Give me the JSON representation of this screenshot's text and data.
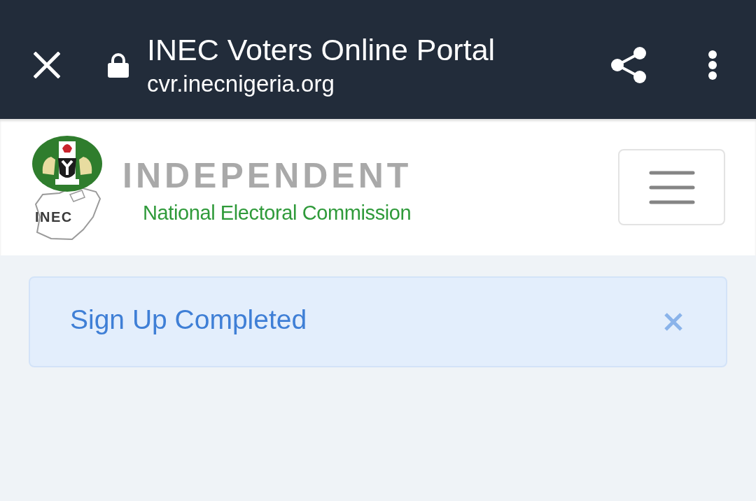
{
  "browser_bar": {
    "title": "INEC Voters Online Portal",
    "url": "cvr.inecnigeria.org",
    "secure": true
  },
  "site_header": {
    "logo_text": "INEC",
    "heading": "INDEPENDENT",
    "subheading": "National Electoral Commission"
  },
  "alert": {
    "message": "Sign Up Completed",
    "dismissible": true
  }
}
